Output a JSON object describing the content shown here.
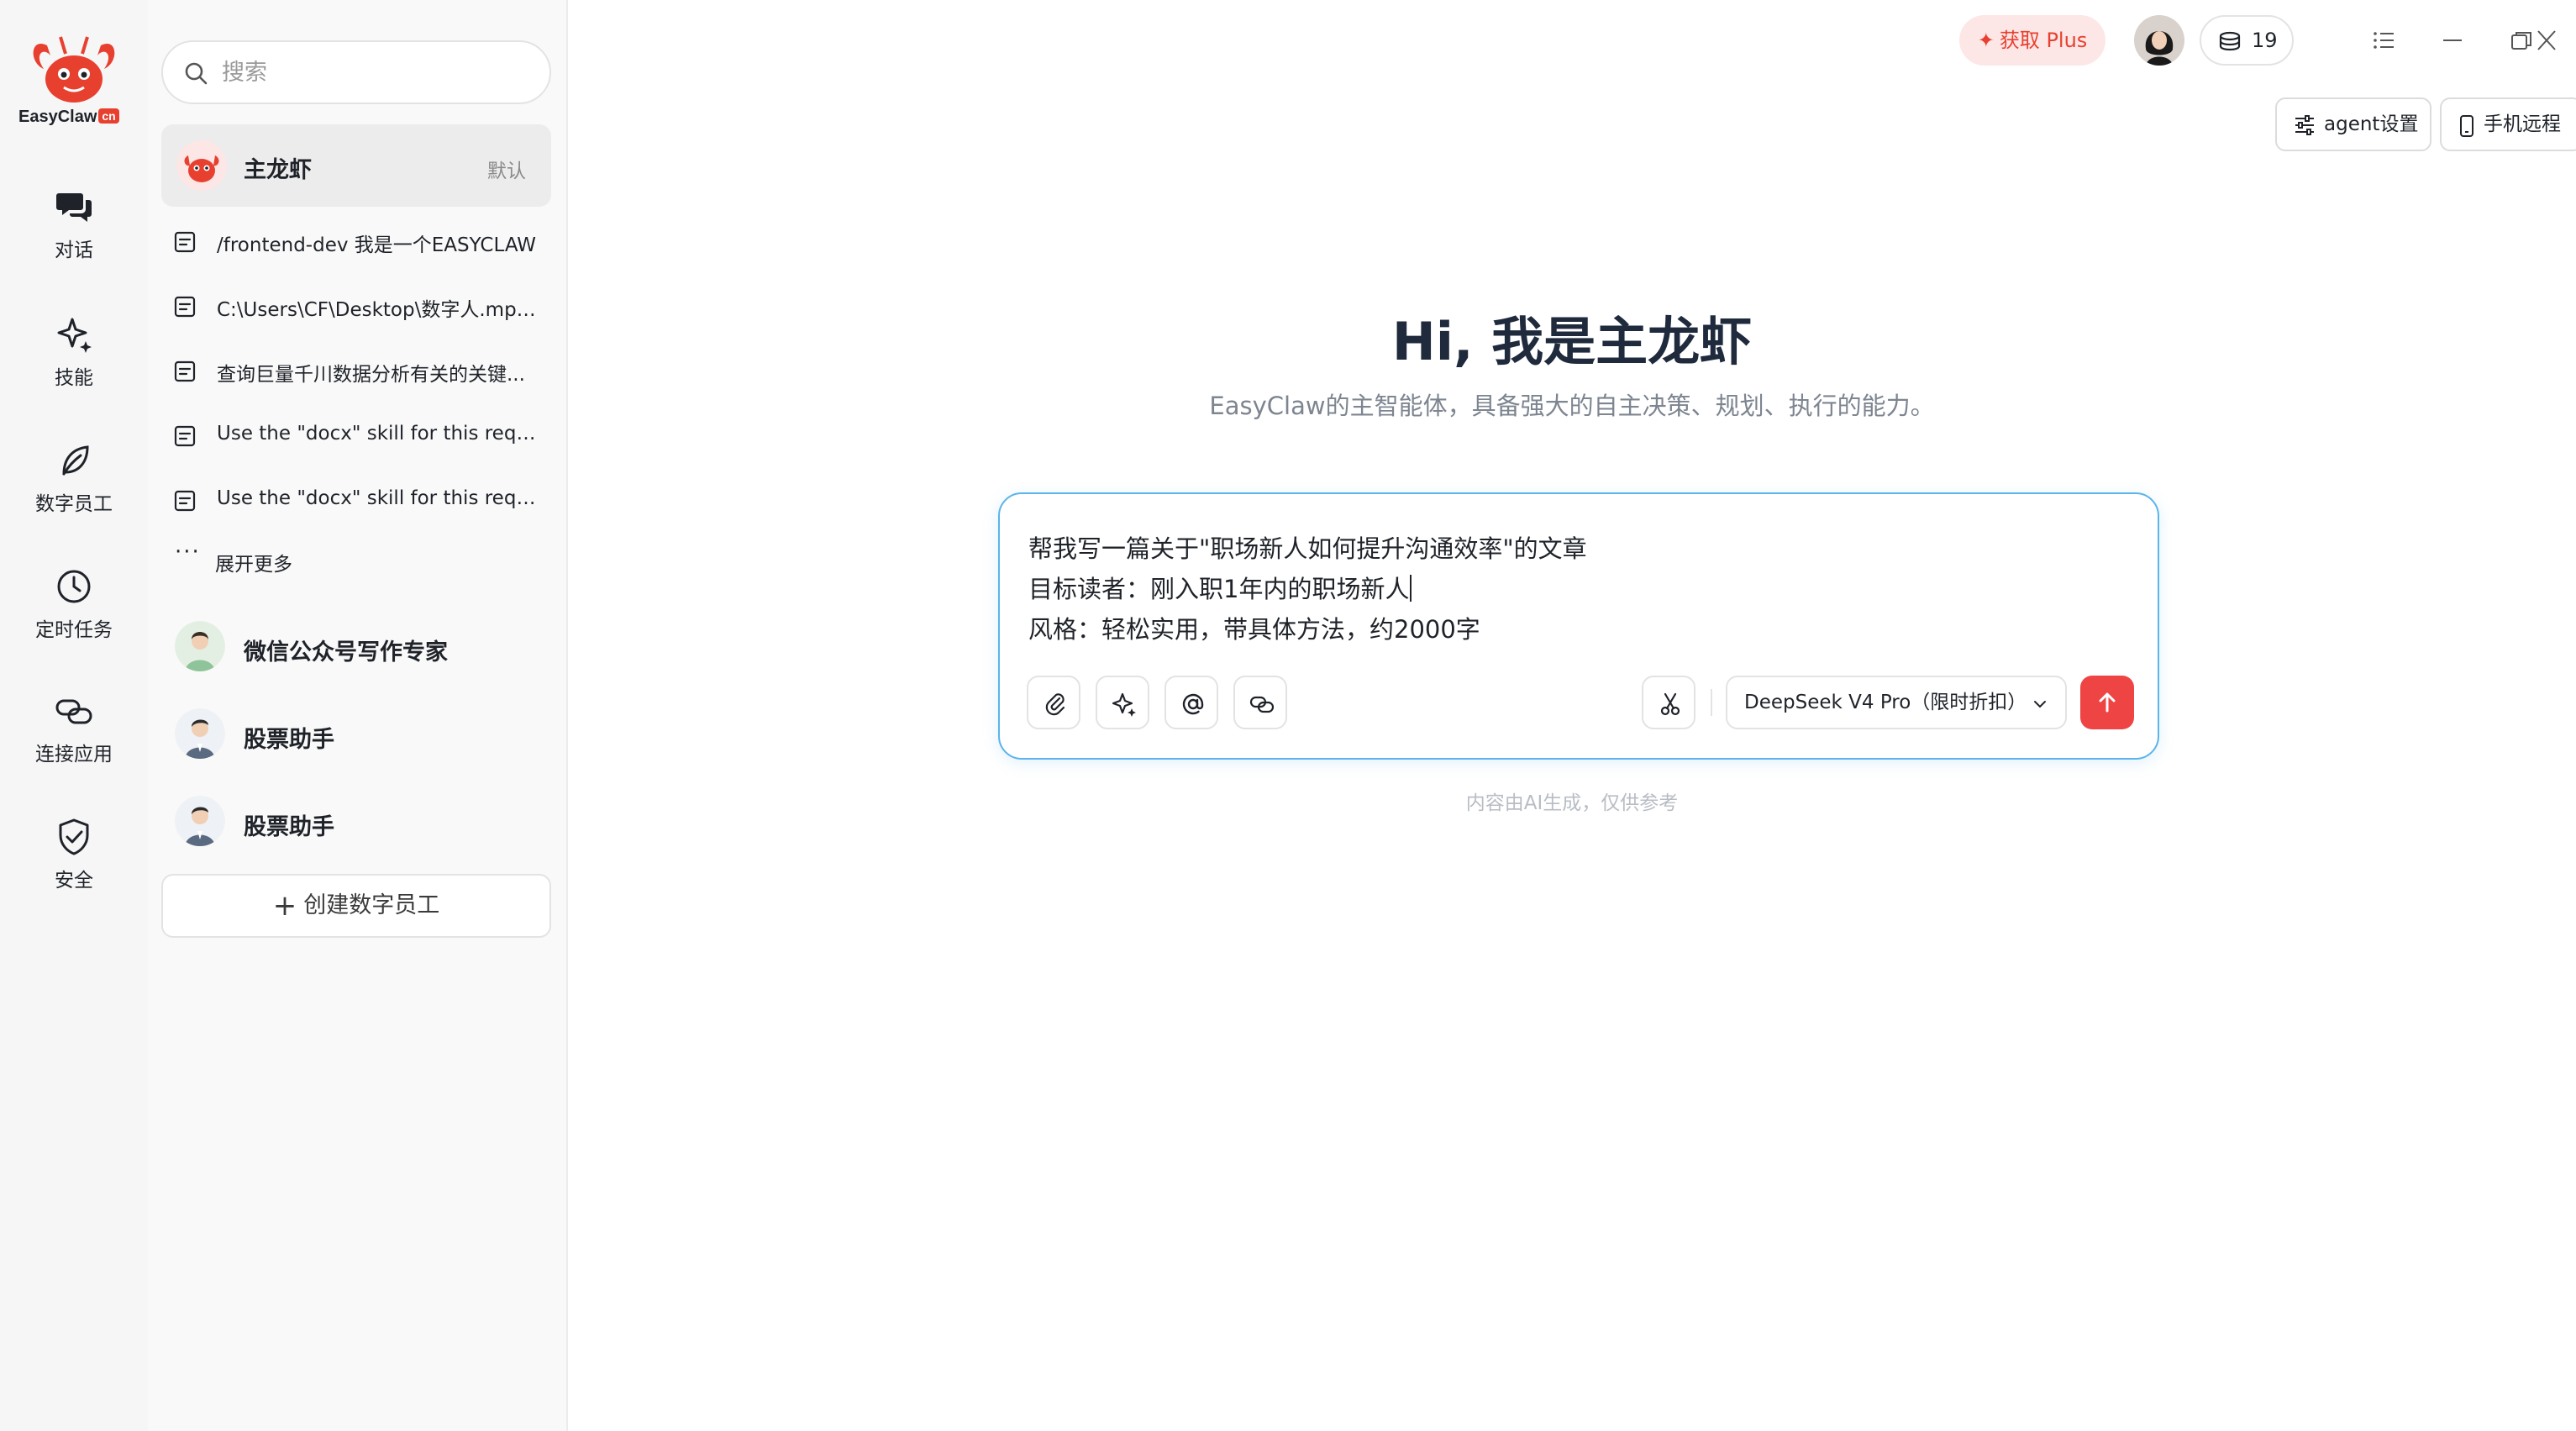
{
  "brand": {
    "name": "EasyClaw",
    "tag": "cn"
  },
  "rail": {
    "items": [
      {
        "label": "对话",
        "icon": "chat-icon"
      },
      {
        "label": "技能",
        "icon": "sparkle-icon"
      },
      {
        "label": "数字员工",
        "icon": "leaf-icon"
      },
      {
        "label": "定时任务",
        "icon": "clock-icon"
      },
      {
        "label": "连接应用",
        "icon": "link-icon"
      },
      {
        "label": "安全",
        "icon": "shield-icon"
      }
    ]
  },
  "panel": {
    "search_placeholder": "搜索",
    "main_agent": {
      "name": "主龙虾",
      "tag": "默认"
    },
    "conversations": [
      "/frontend-dev 我是一个EASYCLAW",
      "C:\\Users\\CF\\Desktop\\数字人.mp4 ...",
      "查询巨量千川数据分析有关的关键...",
      "Use the \"docx\" skill for this reque...",
      "Use the \"docx\" skill for this reque..."
    ],
    "more_label": "展开更多",
    "agents": [
      {
        "name": "微信公众号写作专家"
      },
      {
        "name": "股票助手"
      },
      {
        "name": "股票助手"
      }
    ],
    "create_label": "创建数字员工"
  },
  "topbar": {
    "plus_label": "获取 Plus",
    "credits": "19",
    "agent_settings_label": "agent设置",
    "mobile_remote_label": "手机远程"
  },
  "main": {
    "title": "Hi, 我是主龙虾",
    "subtitle": "EasyClaw的主智能体，具备强大的自主决策、规划、执行的能力。",
    "composer_lines": [
      "帮我写一篇关于\"职场新人如何提升沟通效率\"的文章",
      "目标读者：刚入职1年内的职场新人",
      "风格：轻松实用，带具体方法，约2000字"
    ],
    "model": "DeepSeek V4 Pro（限时折扣）",
    "disclaimer": "内容由AI生成，仅供参考"
  },
  "colors": {
    "accent": "#ef4444",
    "composer_border": "#5bb4ea",
    "plus_bg": "#fde6e6"
  }
}
